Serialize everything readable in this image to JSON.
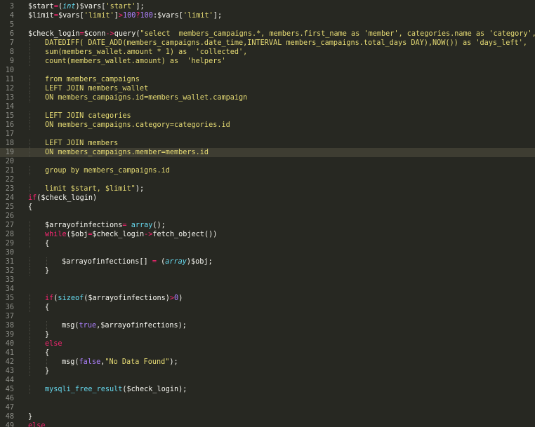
{
  "editor": {
    "colors": {
      "background": "#272822",
      "line_number": "#8f908a",
      "active_line": "#3e3d32",
      "default": "#f8f8f2",
      "keyword": "#f92672",
      "string": "#e6db74",
      "number": "#ae81ff",
      "function": "#66d9ef"
    },
    "active_line_number": "19",
    "lines": [
      {
        "num": "3",
        "tokens": [
          [
            "var",
            "$start"
          ],
          [
            "op",
            "="
          ],
          [
            "default",
            "("
          ],
          [
            "type",
            "int"
          ],
          [
            "default",
            ")$vars["
          ],
          [
            "str",
            "'start'"
          ],
          [
            "default",
            "];"
          ]
        ]
      },
      {
        "num": "4",
        "tokens": [
          [
            "var",
            "$limit"
          ],
          [
            "op",
            "="
          ],
          [
            "default",
            "$vars["
          ],
          [
            "str",
            "'limit'"
          ],
          [
            "default",
            "]"
          ],
          [
            "op",
            ">"
          ],
          [
            "num",
            "100"
          ],
          [
            "op",
            "?"
          ],
          [
            "num",
            "100"
          ],
          [
            "default",
            ":$vars["
          ],
          [
            "str",
            "'limit'"
          ],
          [
            "default",
            "];"
          ]
        ]
      },
      {
        "num": "5",
        "tokens": []
      },
      {
        "num": "6",
        "tokens": [
          [
            "var",
            "$check_login"
          ],
          [
            "op",
            "="
          ],
          [
            "default",
            "$conn"
          ],
          [
            "op",
            "->"
          ],
          [
            "default",
            "query("
          ],
          [
            "str",
            "\"select  members_campaigns.*, members.first_name as 'member', categories.name as 'category',"
          ]
        ]
      },
      {
        "num": "7",
        "indent": 1,
        "tokens": [
          [
            "str",
            "DATEDIFF( DATE_ADD(members_campaigns.date_time,INTERVAL members_campaigns.total_days DAY),NOW()) as 'days_left',"
          ]
        ]
      },
      {
        "num": "8",
        "indent": 1,
        "tokens": [
          [
            "str",
            "sum(members_wallet.amount * 1) as  'collected',"
          ]
        ]
      },
      {
        "num": "9",
        "indent": 1,
        "tokens": [
          [
            "str",
            "count(members_wallet.amount) as  'helpers'"
          ]
        ]
      },
      {
        "num": "10",
        "tokens": []
      },
      {
        "num": "11",
        "indent": 1,
        "tokens": [
          [
            "str",
            "from members_campaigns"
          ]
        ]
      },
      {
        "num": "12",
        "indent": 1,
        "tokens": [
          [
            "str",
            "LEFT JOIN members_wallet"
          ]
        ]
      },
      {
        "num": "13",
        "indent": 1,
        "tokens": [
          [
            "str",
            "ON members_campaigns.id=members_wallet.campaign"
          ]
        ]
      },
      {
        "num": "14",
        "tokens": []
      },
      {
        "num": "15",
        "indent": 1,
        "tokens": [
          [
            "str",
            "LEFT JOIN categories"
          ]
        ]
      },
      {
        "num": "16",
        "indent": 1,
        "tokens": [
          [
            "str",
            "ON members_campaigns.category=categories.id"
          ]
        ]
      },
      {
        "num": "17",
        "tokens": []
      },
      {
        "num": "18",
        "indent": 1,
        "tokens": [
          [
            "str",
            "LEFT JOIN members"
          ]
        ]
      },
      {
        "num": "19",
        "indent": 1,
        "tokens": [
          [
            "str",
            "ON members_campaigns.member=members.id"
          ]
        ]
      },
      {
        "num": "20",
        "tokens": []
      },
      {
        "num": "21",
        "indent": 1,
        "tokens": [
          [
            "str",
            "group by members_campaigns.id"
          ]
        ]
      },
      {
        "num": "22",
        "tokens": []
      },
      {
        "num": "23",
        "indent": 1,
        "tokens": [
          [
            "str",
            "limit $start, $limit\""
          ],
          [
            "default",
            ");"
          ]
        ]
      },
      {
        "num": "24",
        "tokens": [
          [
            "kw",
            "if"
          ],
          [
            "default",
            "($check_login)"
          ]
        ]
      },
      {
        "num": "25",
        "tokens": [
          [
            "default",
            "{"
          ]
        ]
      },
      {
        "num": "26",
        "tokens": []
      },
      {
        "num": "27",
        "indent": 1,
        "tokens": [
          [
            "var",
            "$arrayofinfections"
          ],
          [
            "op",
            "="
          ],
          [
            "default",
            " "
          ],
          [
            "fn",
            "array"
          ],
          [
            "default",
            "();"
          ]
        ]
      },
      {
        "num": "28",
        "indent": 1,
        "tokens": [
          [
            "kw",
            "while"
          ],
          [
            "default",
            "($obj"
          ],
          [
            "op",
            "="
          ],
          [
            "default",
            "$check_login"
          ],
          [
            "op",
            "->"
          ],
          [
            "default",
            "fetch_object())"
          ]
        ]
      },
      {
        "num": "29",
        "indent": 1,
        "tokens": [
          [
            "default",
            "{"
          ]
        ]
      },
      {
        "num": "30",
        "tokens": []
      },
      {
        "num": "31",
        "indent": 2,
        "tokens": [
          [
            "default",
            "$arrayofinfections[] "
          ],
          [
            "op",
            "="
          ],
          [
            "default",
            " ("
          ],
          [
            "type",
            "array"
          ],
          [
            "default",
            ")$obj;"
          ]
        ]
      },
      {
        "num": "32",
        "indent": 1,
        "tokens": [
          [
            "default",
            "}"
          ]
        ]
      },
      {
        "num": "33",
        "tokens": []
      },
      {
        "num": "34",
        "tokens": []
      },
      {
        "num": "35",
        "indent": 1,
        "tokens": [
          [
            "kw",
            "if"
          ],
          [
            "default",
            "("
          ],
          [
            "fn",
            "sizeof"
          ],
          [
            "default",
            "($arrayofinfections)"
          ],
          [
            "op",
            ">"
          ],
          [
            "num",
            "0"
          ],
          [
            "default",
            ")"
          ]
        ]
      },
      {
        "num": "36",
        "indent": 1,
        "tokens": [
          [
            "default",
            "{"
          ]
        ]
      },
      {
        "num": "37",
        "tokens": []
      },
      {
        "num": "38",
        "indent": 2,
        "tokens": [
          [
            "default",
            "msg("
          ],
          [
            "const",
            "true"
          ],
          [
            "default",
            ",$arrayofinfections);"
          ]
        ]
      },
      {
        "num": "39",
        "indent": 1,
        "tokens": [
          [
            "default",
            "}"
          ]
        ]
      },
      {
        "num": "40",
        "indent": 1,
        "tokens": [
          [
            "kw",
            "else"
          ]
        ]
      },
      {
        "num": "41",
        "indent": 1,
        "tokens": [
          [
            "default",
            "{"
          ]
        ]
      },
      {
        "num": "42",
        "indent": 2,
        "tokens": [
          [
            "default",
            "msg("
          ],
          [
            "const",
            "false"
          ],
          [
            "default",
            ","
          ],
          [
            "str",
            "\"No Data Found\""
          ],
          [
            "default",
            ");"
          ]
        ]
      },
      {
        "num": "43",
        "indent": 1,
        "tokens": [
          [
            "default",
            "}"
          ]
        ]
      },
      {
        "num": "44",
        "tokens": []
      },
      {
        "num": "45",
        "indent": 1,
        "tokens": [
          [
            "fn",
            "mysqli_free_result"
          ],
          [
            "default",
            "($check_login);"
          ]
        ]
      },
      {
        "num": "46",
        "tokens": []
      },
      {
        "num": "47",
        "tokens": []
      },
      {
        "num": "48",
        "tokens": [
          [
            "default",
            "}"
          ]
        ]
      },
      {
        "num": "49",
        "tokens": [
          [
            "kw",
            "else"
          ]
        ]
      }
    ]
  }
}
